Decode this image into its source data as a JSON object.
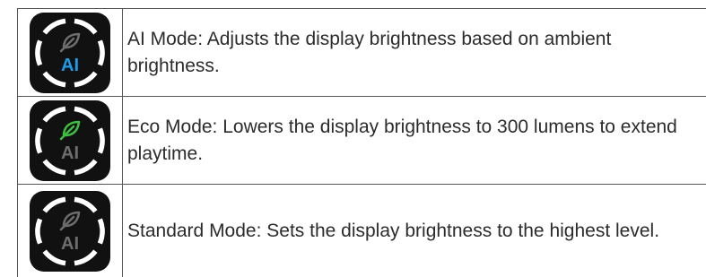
{
  "colors": {
    "icon_background": "#111111",
    "ring": "#ffffff",
    "active_blue": "#1e9be8",
    "active_green": "#3fbf3f",
    "inactive_gray": "#6d6d6d",
    "border": "#555555",
    "text": "#2b2b2b"
  },
  "modes": [
    {
      "icon": "ai-mode-icon",
      "badge_text": "AI",
      "active": "ai",
      "description": "AI Mode: Adjusts the display brightness based on ambient brightness."
    },
    {
      "icon": "eco-mode-icon",
      "badge_text": "AI",
      "active": "eco",
      "description": "Eco Mode: Lowers the display brightness to 300 lumens to extend playtime."
    },
    {
      "icon": "standard-mode-icon",
      "badge_text": "AI",
      "active": "standard",
      "description": "Standard Mode: Sets the display brightness to the highest level."
    }
  ]
}
